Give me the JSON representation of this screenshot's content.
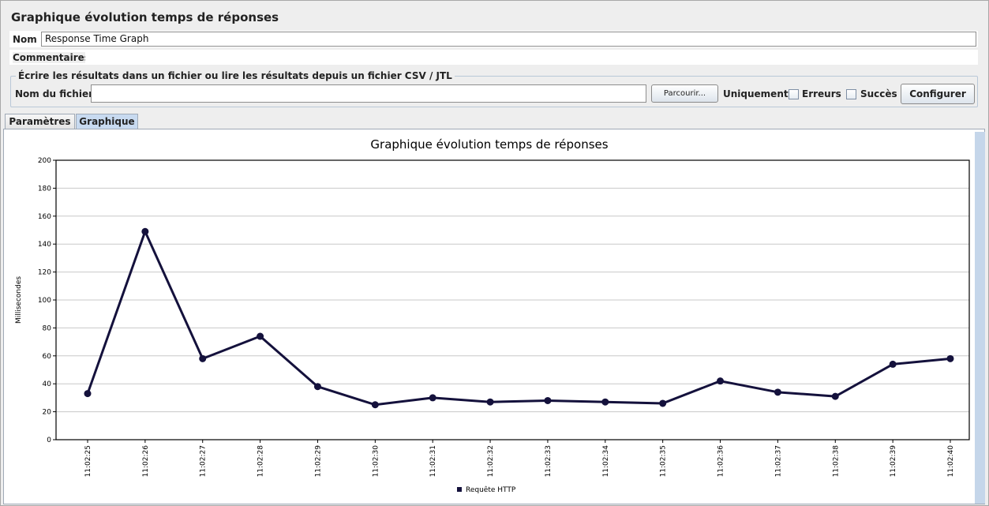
{
  "panel": {
    "title": "Graphique évolution temps de réponses"
  },
  "name_field": {
    "label": "Nom :",
    "value": "Response Time Graph"
  },
  "comments_field": {
    "label": "Commentaires :",
    "value": ""
  },
  "file_section": {
    "legend": "Écrire les résultats dans un fichier ou lire les résultats depuis un fichier CSV / JTL",
    "filename_label": "Nom du fichier :",
    "filename_value": "",
    "browse_label": "Parcourir...",
    "only_label": "Uniquement :",
    "errors_label": "Erreurs",
    "errors_checked": false,
    "success_label": "Succès",
    "success_checked": false,
    "configure_label": "Configurer"
  },
  "tabs": [
    {
      "label": "Paramètres",
      "active": false
    },
    {
      "label": "Graphique",
      "active": true
    }
  ],
  "chart_data": {
    "type": "line",
    "title": "Graphique évolution temps de réponses",
    "ylabel": "Millisecondes",
    "xlabel": "",
    "ylim": [
      0,
      200
    ],
    "yticks": [
      0,
      20,
      40,
      60,
      80,
      100,
      120,
      140,
      160,
      180,
      200
    ],
    "categories": [
      "11:02:25",
      "11:02:26",
      "11:02:27",
      "11:02:28",
      "11:02:29",
      "11:02:30",
      "11:02:31",
      "11:02:32",
      "11:02:33",
      "11:02:34",
      "11:02:35",
      "11:02:36",
      "11:02:37",
      "11:02:38",
      "11:02:39",
      "11:02:40"
    ],
    "series": [
      {
        "name": "Requête HTTP",
        "color": "#14113c",
        "values": [
          33,
          149,
          58,
          74,
          38,
          25,
          30,
          27,
          28,
          27,
          26,
          42,
          34,
          31,
          54,
          58
        ]
      }
    ],
    "grid": true,
    "legend_position": "bottom"
  }
}
